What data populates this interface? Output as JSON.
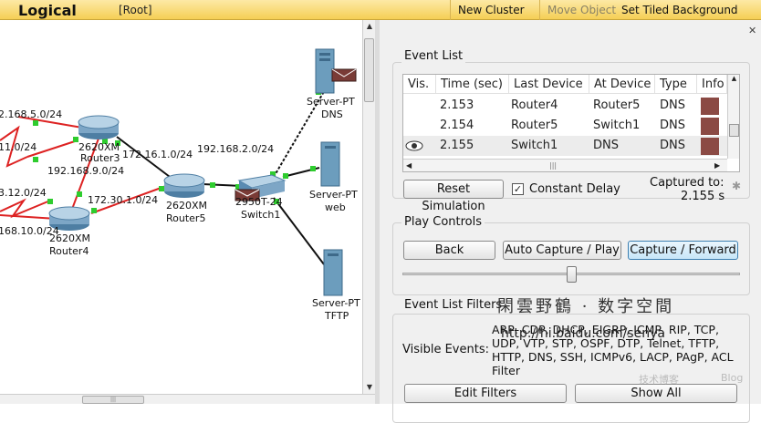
{
  "toolbar": {
    "view_name": "Logical",
    "root_label": "[Root]",
    "new_cluster": "New Cluster",
    "move_object": "Move Object",
    "set_tiled_background": "Set Tiled Background",
    "close_glyph": "✕"
  },
  "topology": {
    "subnets": {
      "s1": "2.168.5.0/24",
      "s2": "11.0/24",
      "s3": "192.168.9.0/24",
      "s4": "3.12.0/24",
      "s5": "172.30.1.0/24",
      "s6": "168.10.0/24",
      "s7": "172.16.1.0/24",
      "s8": "192.168.2.0/24"
    },
    "devices": {
      "router3_model": "2620XM",
      "router3_name": "Router3",
      "router5_model": "2620XM",
      "router5_name": "Router5",
      "router4_model": "2620XM",
      "router4_name": "Router4",
      "switch1_model": "2950T-24",
      "switch1_name": "Switch1",
      "dns_model": "Server-PT",
      "dns_name": "DNS",
      "web_model": "Server-PT",
      "web_name": "web",
      "tftp_model": "Server-PT",
      "tftp_name": "TFTP"
    }
  },
  "event_list": {
    "title": "Event List",
    "columns": [
      "Vis.",
      "Time (sec)",
      "Last Device",
      "At Device",
      "Type",
      "Info"
    ],
    "rows": [
      {
        "vis": "",
        "time": "2.153",
        "last": "Router4",
        "at": "Router5",
        "type": "DNS"
      },
      {
        "vis": "",
        "time": "2.154",
        "last": "Router5",
        "at": "Switch1",
        "type": "DNS"
      },
      {
        "vis": "eye",
        "time": "2.155",
        "last": "Switch1",
        "at": "DNS",
        "type": "DNS"
      }
    ],
    "reset_button": "Reset Simulation",
    "constant_delay_label": "Constant Delay",
    "constant_delay_checked": true,
    "captured_to_label": "Captured to:",
    "captured_to_value": "2.155 s",
    "info_color": "#8b4a44"
  },
  "play_controls": {
    "title": "Play Controls",
    "back": "Back",
    "auto_capture": "Auto Capture / Play",
    "capture_forward": "Capture / Forward",
    "speed_fraction": 0.5
  },
  "filters": {
    "title": "Event List Filters",
    "visible_events_label": "Visible Events:",
    "visible_events": "ARP, CDP, DHCP, EIGRP, ICMP, RIP, TCP, UDP, VTP, STP, OSPF, DTP, Telnet, TFTP, HTTP, DNS, SSH, ICMPv6, LACP, PAgP, ACL Filter",
    "edit_filters": "Edit Filters",
    "show_all": "Show All"
  },
  "watermark": {
    "cjk": "閑雲野鶴 · 数字空間",
    "url": "http://hi.baidu.com/senya",
    "blog_cn": "技术博客",
    "blog_en": "Blog"
  }
}
